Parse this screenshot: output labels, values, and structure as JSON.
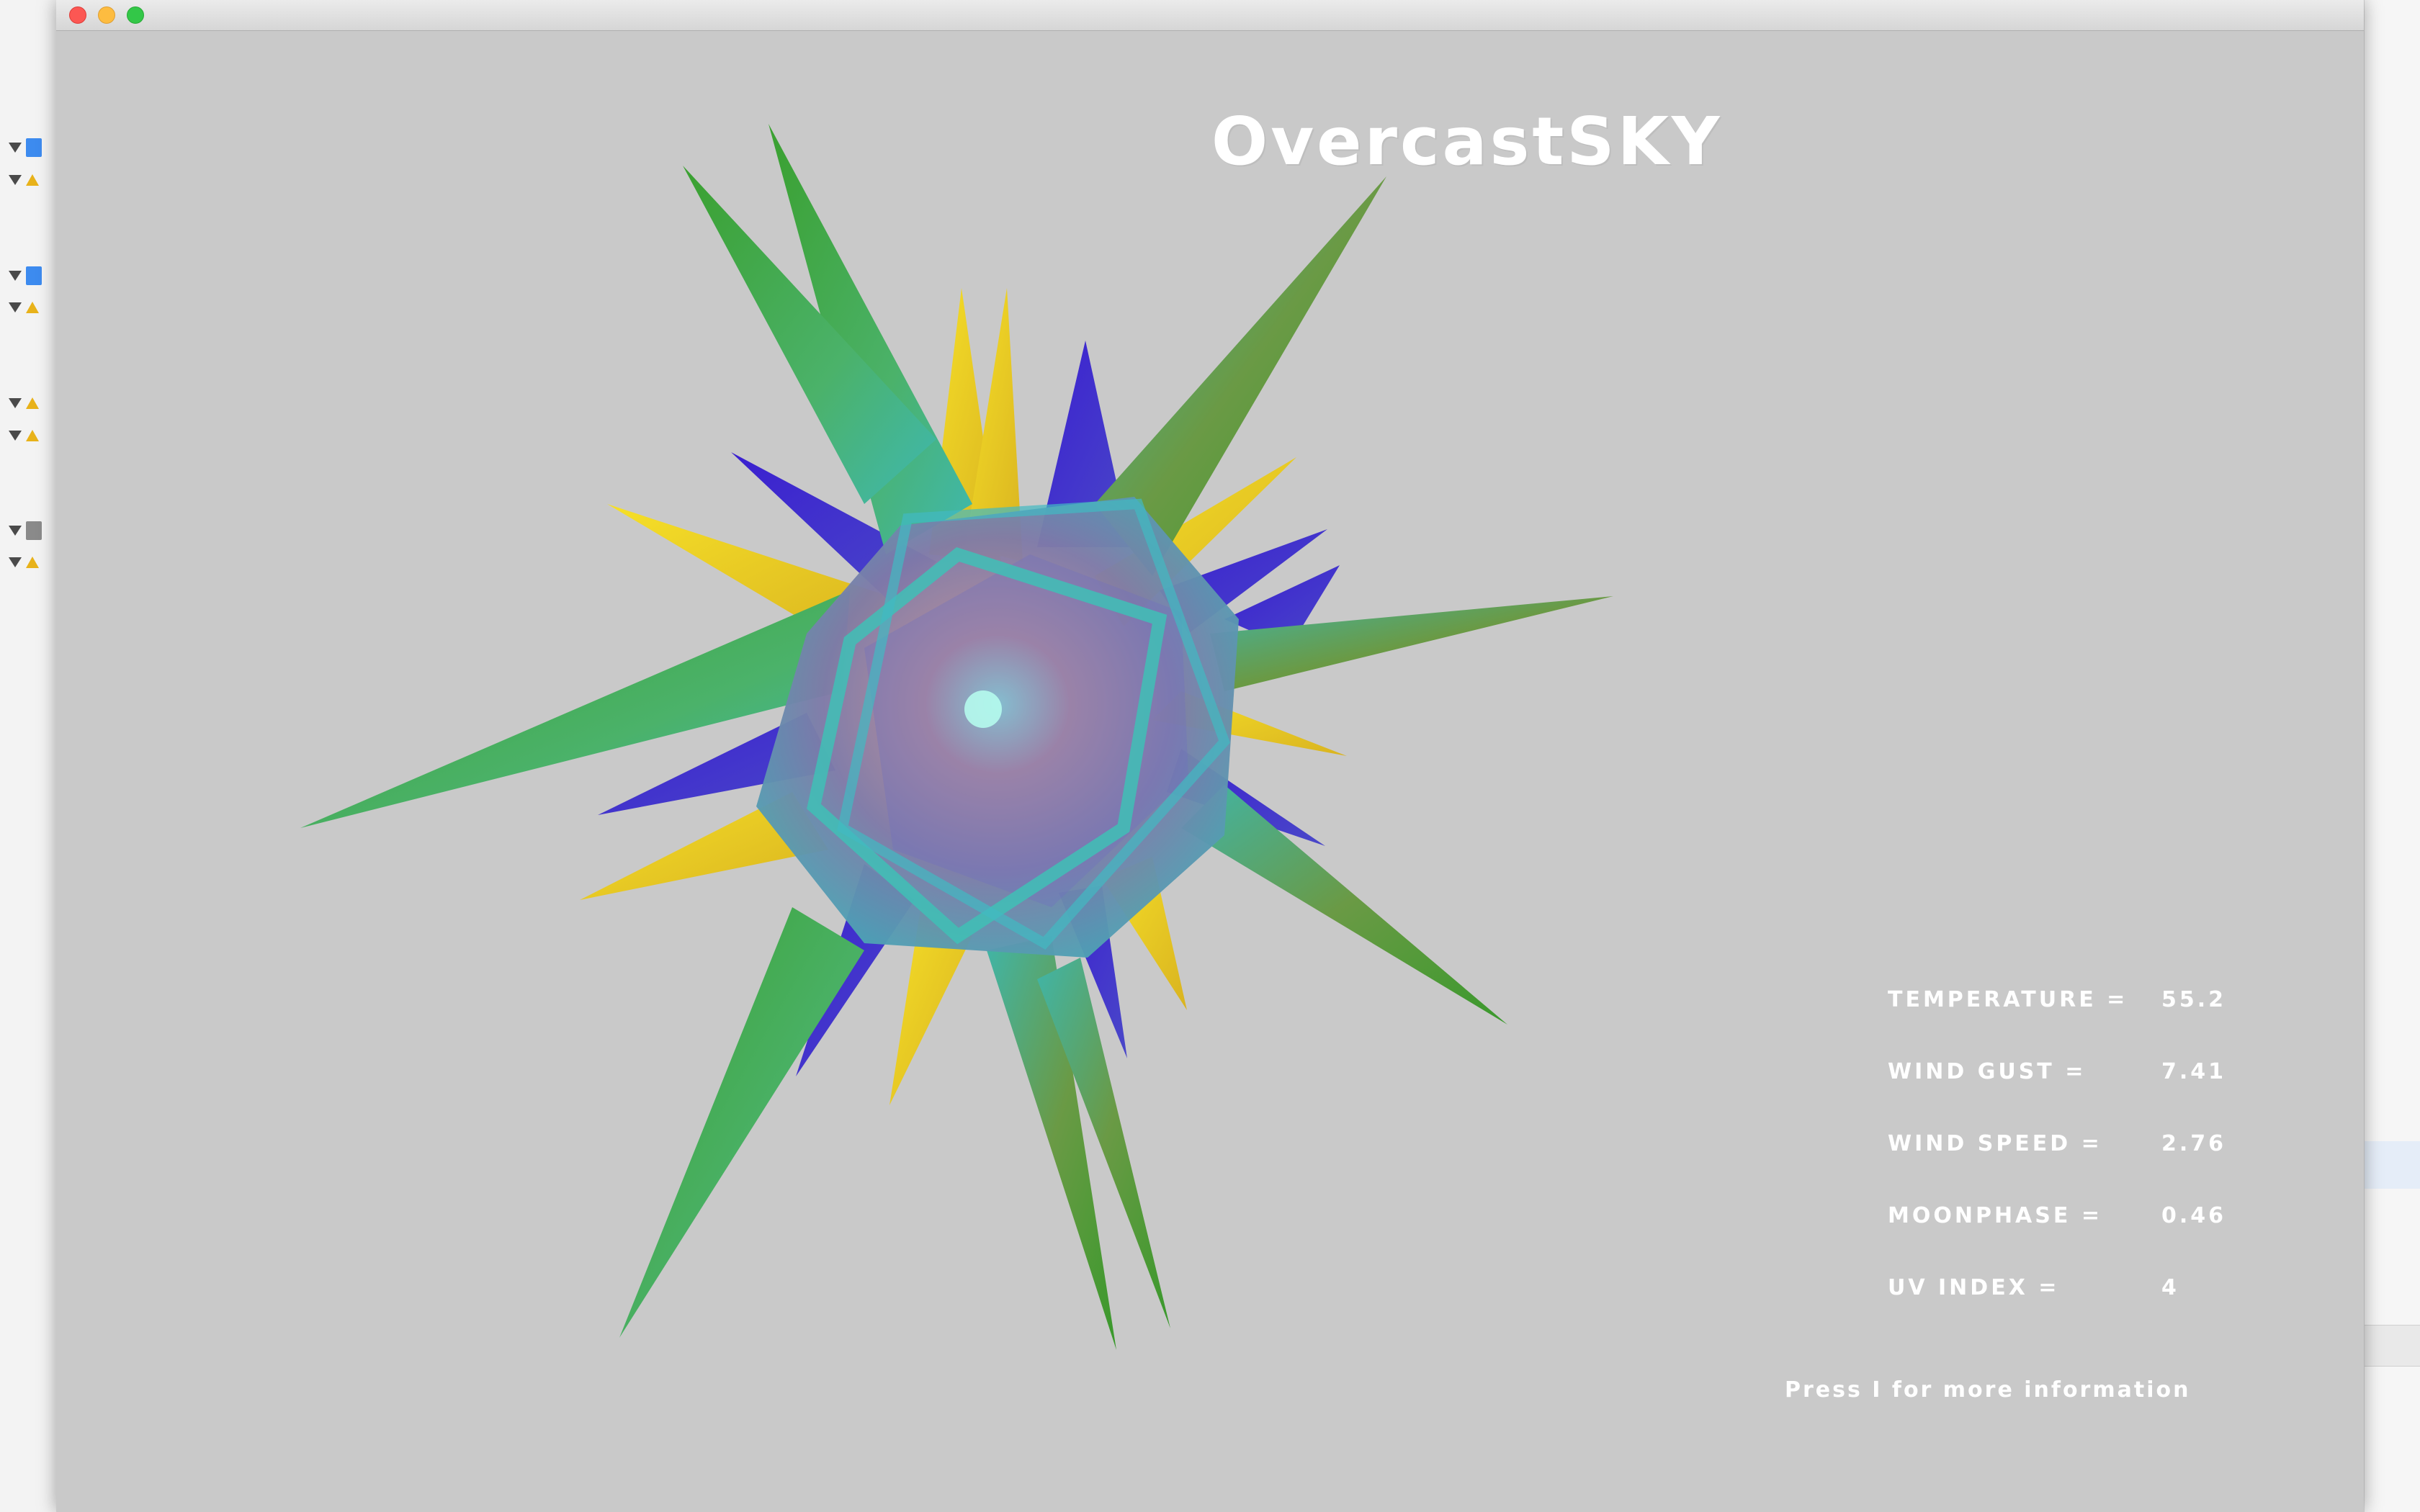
{
  "app": {
    "title": "OvercastSKY"
  },
  "stats": [
    {
      "label": "TEMPERATURE =",
      "value": "55.2"
    },
    {
      "label": "WIND GUST =",
      "value": "7.41"
    },
    {
      "label": "WIND SPEED =",
      "value": "2.76"
    },
    {
      "label": "MOONPHASE =",
      "value": "0.46"
    },
    {
      "label": "UV INDEX =",
      "value": "4"
    }
  ],
  "hint": "Press I for more information",
  "colors": {
    "background": "#c9c9c9",
    "spike_green": "#3a9a35",
    "spike_yellow": "#f0d020",
    "spike_blue": "#3a2ed0",
    "spike_teal": "#3fb8b0",
    "text": "#ffffff"
  },
  "window_controls": {
    "close": "close-icon",
    "minimize": "minimize-icon",
    "maximize": "maximize-icon"
  }
}
